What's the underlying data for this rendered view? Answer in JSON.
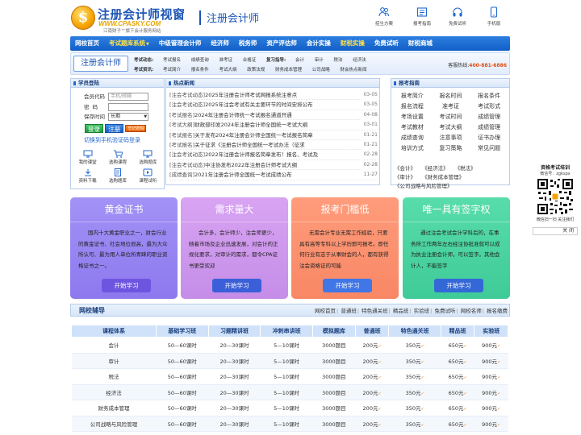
{
  "header": {
    "logo_cn": "注册会计师视窗",
    "logo_url": "WWW.CPASKY.COM",
    "logo_tag": "江南财子™旗下会计服务网站",
    "site_name": "注册会计师",
    "top_links": [
      {
        "label": "招生方案",
        "icon": "people-icon"
      },
      {
        "label": "报考指南",
        "icon": "book-icon"
      },
      {
        "label": "免费试听",
        "icon": "headphone-icon"
      },
      {
        "label": "手机版",
        "icon": "mobile-icon"
      }
    ]
  },
  "main_nav": [
    "网校首页",
    "考试题库系统",
    "中级管理会计师",
    "经济师",
    "税务师",
    "资产评估师",
    "会计实操",
    "财税实操",
    "免费试听",
    "财税商城"
  ],
  "sub_nav": {
    "title": "注册会计师",
    "row1_label": "考试动态:",
    "row1": [
      "考试报名",
      "成绩查询",
      "准考证",
      "合格证"
    ],
    "row1b_label": "复习指导:",
    "row1b": [
      "会计",
      "审计",
      "税法",
      "经济法"
    ],
    "row2_label": "考试资讯:",
    "row2": [
      "考试简介",
      "报名条件",
      "考试大纲",
      "政策法规",
      "财务成本管理",
      "公司战略",
      "财会热点新闻"
    ],
    "hotline_label": "客服热线:",
    "hotline": "400-881-6886"
  },
  "login": {
    "title": "学员登陆",
    "user_label": "会员代码",
    "user_placeholder": "手机/邮箱",
    "pass_label": "密  码",
    "keep_label": "保存时间",
    "keep_value": "长期",
    "login_btn": "登录",
    "register_btn": "注册",
    "forgot_btn": "忘记密码",
    "switch_phone": "切换到手机验证码登录",
    "quick": [
      "我的课堂",
      "选购课程",
      "选购题库",
      "资料下载",
      "选购题库",
      "课程试听"
    ]
  },
  "hot": {
    "title": "热点新闻",
    "items": [
      {
        "cat": "[注会考试动态]",
        "title": "2025年注册会计师考试网报系统注意点",
        "date": "03-05"
      },
      {
        "cat": "[注会考试动态]",
        "title": "2025年注会考试有关主要环节的时间安排公布",
        "date": "03-05"
      },
      {
        "cat": "[考试报名]",
        "title": "2024年注册会计师统一考试报名通道开通",
        "date": "04-08"
      },
      {
        "cat": "[考试大纲]",
        "title": "财政部印发2024年注册会计师全国统一考试大纲",
        "date": "03-01"
      },
      {
        "cat": "[考试报名]",
        "title": "关于发布2024年注册会计师全国统一考试报名简章",
        "date": "01-21"
      },
      {
        "cat": "[考试报名]",
        "title": "关于征求《注册会计师全国统一考试办法（征求",
        "date": "01-21"
      },
      {
        "cat": "[注会考试动态]",
        "title": "2022年注册会计师报名简章发布！报名、考试及",
        "date": "02-28"
      },
      {
        "cat": "[注会考试动态]",
        "title": "中注协发布2022年注册会计师考试大纲",
        "date": "02-28"
      },
      {
        "cat": "[成绩查询]",
        "title": "2021年注册会计师全国统一考试成绩公布",
        "date": "11-27"
      }
    ]
  },
  "guide": {
    "title": "报考指南",
    "items": [
      "报考简介",
      "报名时间",
      "报名条件",
      "报名流程",
      "准考证",
      "考试形式",
      "考场设置",
      "考试时间",
      "成绩管理",
      "考试教材",
      "考试大纲",
      "成绩管理",
      "成绩查询",
      "注意事项",
      "证书办理",
      "培训方式",
      "复习策略",
      "常见问题"
    ],
    "links": [
      "《会计》",
      "《经济法》",
      "《税法》",
      "《审计》",
      "《财务成本管理》",
      "《公司战略与风险管理》"
    ]
  },
  "qr": {
    "title": "资格考试培训",
    "sub": "微信号：zgkspx",
    "caption": "微信扫一扫 关注我们",
    "close": "关 闭"
  },
  "cards": [
    {
      "title": "黄金证书",
      "body": "国内十大黄金职业之一，财会行业的黄金证书、社会地位很高，最为大众所认可、最为用人单位所青睐的职业资格证书之一。",
      "btn": "开始学习"
    },
    {
      "title": "需求量大",
      "body": "会计多，会计师少，注会师更少，随着市场及企业迅速发展，对会计的正规化要求，对审计的需求，都令CPA证书更受欢迎",
      "btn": "开始学习"
    },
    {
      "title": "报考门槛低",
      "body": "无需会计专业无需工作经验，只要具有高等专科以上学历即可报考。即任何行业有志于从事财会的人，都有获得注会资格证的可能",
      "btn": "开始学习"
    },
    {
      "title": "唯一具有签字权",
      "body": "通过注会考试会计学科后的，在事务所工作两年左右经注协批准就可以成为执业注册会计师，可以签字。其他会计人，不能签字",
      "btn": "开始学习"
    }
  ],
  "courses": {
    "title": "网校辅导",
    "links": [
      "网校首页",
      "普通班",
      "特色通关班",
      "精品班",
      "实验班",
      "免费试听",
      "网校名师",
      "报名缴费"
    ],
    "headers": [
      "课程体系",
      "基础学习班",
      "习题精讲班",
      "冲刺串讲班",
      "模拟题库",
      "普通班",
      "特色通关班",
      "精品班",
      "实验班"
    ],
    "rows": [
      [
        "会计",
        "50—60课时",
        "20—30课时",
        "5—10课时",
        "3000题目",
        "200元",
        "350元",
        "650元",
        "900元"
      ],
      [
        "审计",
        "50—60课时",
        "20—30课时",
        "5—10课时",
        "3000题目",
        "200元",
        "350元",
        "650元",
        "900元"
      ],
      [
        "税法",
        "50—60课时",
        "20—30课时",
        "5—10课时",
        "3000题目",
        "200元",
        "350元",
        "650元",
        "900元"
      ],
      [
        "经济法",
        "50—60课时",
        "20—30课时",
        "5—10课时",
        "3000题目",
        "200元",
        "350元",
        "650元",
        "900元"
      ],
      [
        "财务成本管理",
        "50—60课时",
        "20—30课时",
        "5—10课时",
        "3000题目",
        "200元",
        "350元",
        "650元",
        "900元"
      ],
      [
        "公司战略与风险管理",
        "50—60课时",
        "20—30课时",
        "5—10课时",
        "3000题目",
        "200元",
        "350元",
        "650元",
        "900元"
      ]
    ]
  },
  "colors": {
    "brand_blue": "#1d55b5",
    "nav_blue": "#125fc7",
    "hotline_orange": "#e04b12",
    "login_green": "#1d9a3e"
  }
}
